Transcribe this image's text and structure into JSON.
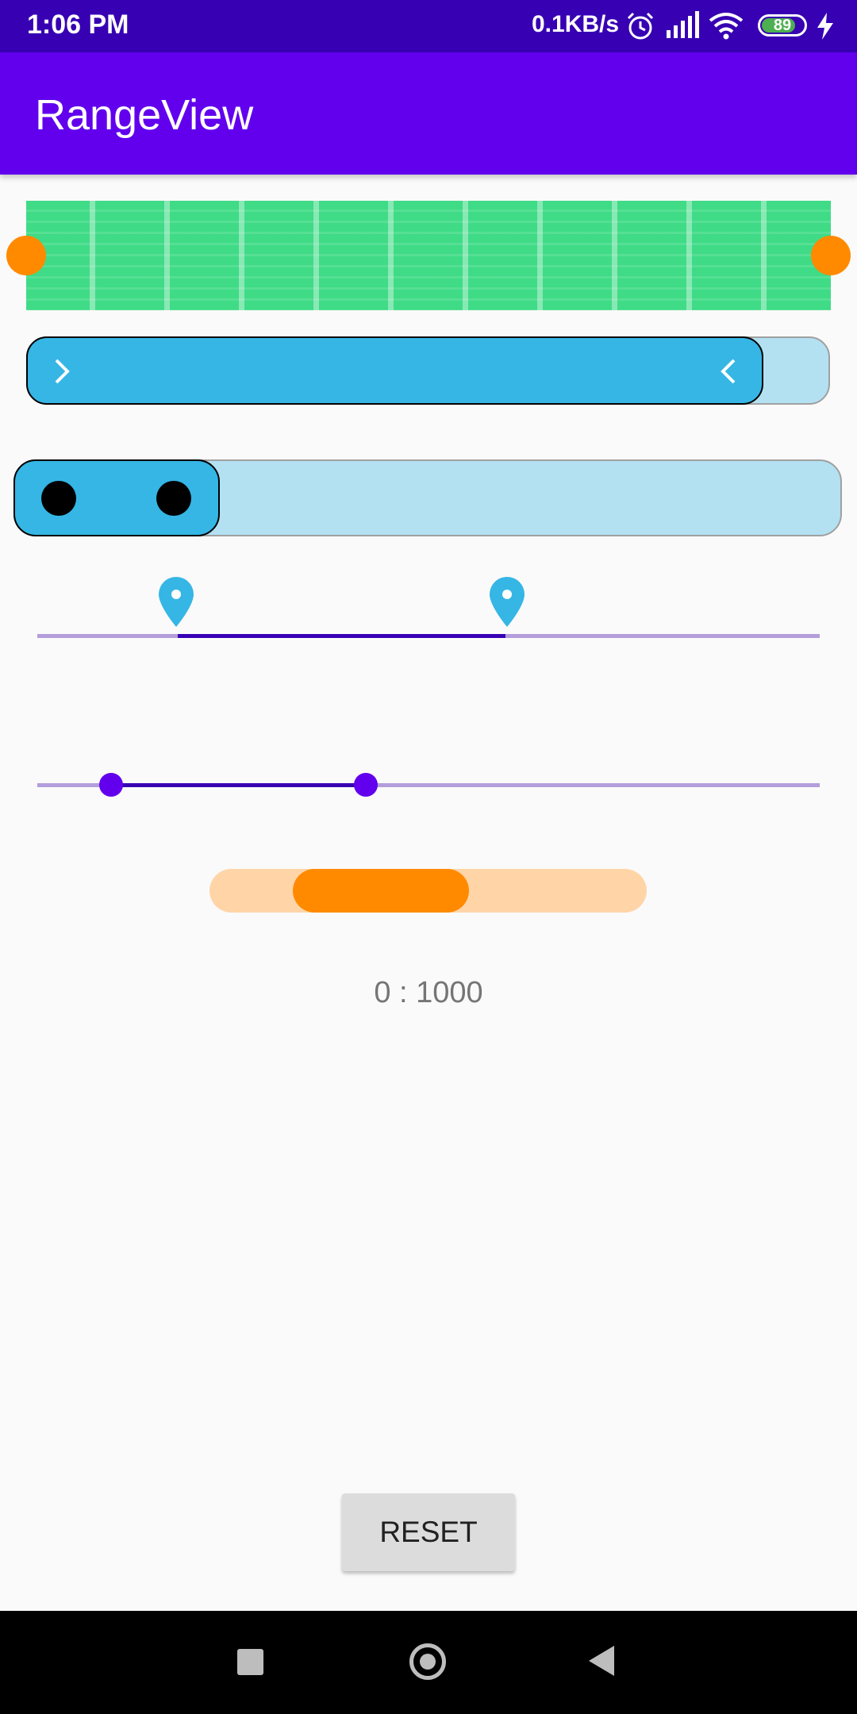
{
  "status_bar": {
    "time": "1:06 PM",
    "network_speed": "0.1KB/s",
    "battery_level": "89",
    "icons": [
      "alarm-icon",
      "signal-icon",
      "wifi-icon",
      "battery-icon",
      "charging-icon"
    ]
  },
  "app_bar": {
    "title": "RangeView"
  },
  "range_readout": "0 : 1000",
  "reset_label": "RESET",
  "colors": {
    "primary": "#6200EE",
    "primary_dark": "#3700B3",
    "accent_blue": "#35B6E5",
    "accent_green": "#3FDB86",
    "accent_orange": "#FF8A00"
  },
  "nav_bar": {
    "buttons": [
      "recents-button",
      "home-button",
      "back-button"
    ]
  }
}
